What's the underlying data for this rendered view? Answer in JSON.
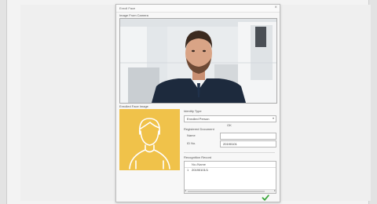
{
  "dialog": {
    "title": "Enroll Face",
    "close_glyph": "×"
  },
  "live": {
    "label": "Image From Camera"
  },
  "enrolled": {
    "label": "Enrolled Face Image"
  },
  "identity": {
    "label": "Identity Type",
    "select_value": "Enrolled Person",
    "select_arrow": "▾"
  },
  "document": {
    "label": "Registered Document",
    "ok_text": "OK",
    "fields": [
      {
        "label": "Name",
        "value": ""
      },
      {
        "label": "ID No.",
        "value": "20190101"
      }
    ]
  },
  "records": {
    "label": "Recognition Record",
    "header": "No./Name",
    "rows": [
      {
        "index": "1",
        "text": "20190101/1"
      }
    ],
    "scroll_left": "◂",
    "scroll_right": "▸"
  },
  "colors": {
    "avatar_bg": "#f0c24a",
    "confirm": "#3aa63a"
  },
  "icons": {
    "avatar": "person-outline-icon",
    "confirm": "checkmark-icon",
    "close": "close-icon"
  }
}
